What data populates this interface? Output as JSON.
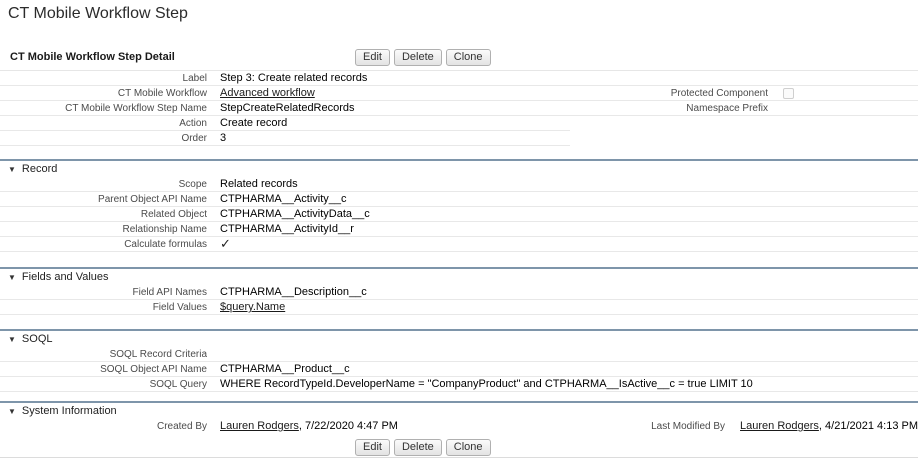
{
  "colors": {
    "section_divider": "#7e95aa",
    "row_divider": "#e8e8e8",
    "button_border": "#b0b0b0",
    "label_text": "#4b4b4b",
    "value_text": "#000000"
  },
  "icons": {
    "section_collapse": "▼",
    "checkmark": "✓"
  },
  "page": {
    "title": "CT Mobile Workflow Step"
  },
  "detail": {
    "title": "CT Mobile Workflow Step Detail",
    "buttons": {
      "edit": "Edit",
      "delete": "Delete",
      "clone": "Clone"
    }
  },
  "overview": {
    "left_rows": [
      {
        "label": "Label",
        "value": "Step 3: Create related records"
      },
      {
        "label": "CT Mobile Workflow",
        "value": "Advanced workflow",
        "is_link": true
      },
      {
        "label": "CT Mobile Workflow Step Name",
        "value": "StepCreateRelatedRecords"
      },
      {
        "label": "Action",
        "value": "Create record"
      },
      {
        "label": "Order",
        "value": "3"
      }
    ],
    "right_rows": [
      {
        "label": "Protected Component",
        "value": "",
        "control": "checkbox",
        "checked": false
      },
      {
        "label": "Namespace Prefix",
        "value": ""
      }
    ]
  },
  "record_section": {
    "title": "Record",
    "rows": [
      {
        "label": "Scope",
        "value": "Related records"
      },
      {
        "label": "Parent Object API Name",
        "value": "CTPHARMA__Activity__c"
      },
      {
        "label": "Related Object",
        "value": "CTPHARMA__ActivityData__c"
      },
      {
        "label": "Relationship Name",
        "value": "CTPHARMA__ActivityId__r"
      },
      {
        "label": "Calculate formulas",
        "value": "",
        "control": "checkbox",
        "checked": true
      }
    ]
  },
  "fields_section": {
    "title": "Fields and Values",
    "rows": [
      {
        "label": "Field API Names",
        "value": "CTPHARMA__Description__c"
      },
      {
        "label": "Field Values",
        "value": "$query.Name",
        "is_link": true
      }
    ]
  },
  "soql_section": {
    "title": "SOQL",
    "rows": [
      {
        "label": "SOQL Record Criteria",
        "value": ""
      },
      {
        "label": "SOQL Object API Name",
        "value": "CTPHARMA__Product__c"
      },
      {
        "label": "SOQL Query",
        "value": "WHERE RecordTypeId.DeveloperName = \"CompanyProduct\" and CTPHARMA__IsActive__c = true LIMIT 10"
      }
    ]
  },
  "system_section": {
    "title": "System Information",
    "created_by": {
      "label": "Created By",
      "link": "Lauren Rodgers",
      "suffix": ", 7/22/2020 4:47 PM"
    },
    "last_modified_by": {
      "label": "Last Modified By",
      "link": "Lauren Rodgers",
      "suffix": ", 4/21/2021 4:13 PM"
    }
  }
}
